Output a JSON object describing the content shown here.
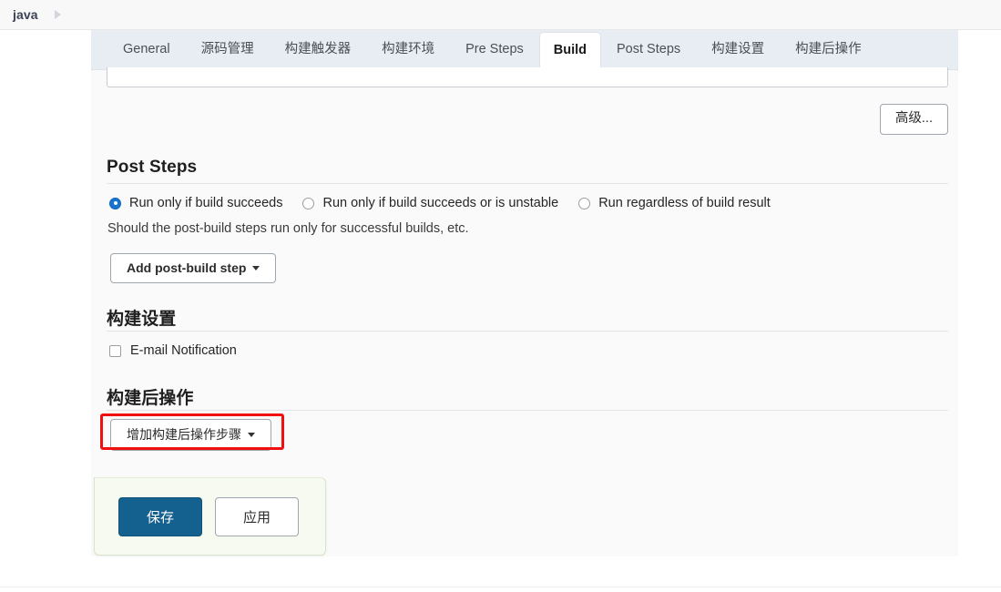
{
  "breadcrumb": {
    "items": [
      {
        "label": "java"
      }
    ],
    "caret_icon": "chevron-right-icon"
  },
  "tabs": [
    {
      "label": "General",
      "active": false
    },
    {
      "label": "源码管理",
      "active": false
    },
    {
      "label": "构建触发器",
      "active": false
    },
    {
      "label": "构建环境",
      "active": false
    },
    {
      "label": "Pre Steps",
      "active": false
    },
    {
      "label": "Build",
      "active": true
    },
    {
      "label": "Post Steps",
      "active": false
    },
    {
      "label": "构建设置",
      "active": false
    },
    {
      "label": "构建后操作",
      "active": false
    }
  ],
  "build_section": {
    "advanced_button_label": "高级...",
    "text_field_value": ""
  },
  "post_steps": {
    "title": "Post Steps",
    "radio_options": [
      {
        "label": "Run only if build succeeds",
        "checked": true
      },
      {
        "label": "Run only if build succeeds or is unstable",
        "checked": false
      },
      {
        "label": "Run regardless of build result",
        "checked": false
      }
    ],
    "helper_text": "Should the post-build steps run only for successful builds, etc.",
    "add_step_button_label": "Add post-build step",
    "add_step_caret_icon": "caret-down-icon"
  },
  "build_settings": {
    "title": "构建设置",
    "checkboxes": [
      {
        "label": "E-mail Notification",
        "checked": false
      }
    ]
  },
  "post_build_actions": {
    "title": "构建后操作",
    "add_action_button_label": "增加构建后操作步骤",
    "add_action_caret_icon": "caret-down-icon",
    "highlighted": true,
    "highlight_color": "#f01010"
  },
  "save_bar": {
    "save_label": "保存",
    "apply_label": "应用",
    "save_color": "#14618f",
    "background_color": "#f6faf0"
  }
}
